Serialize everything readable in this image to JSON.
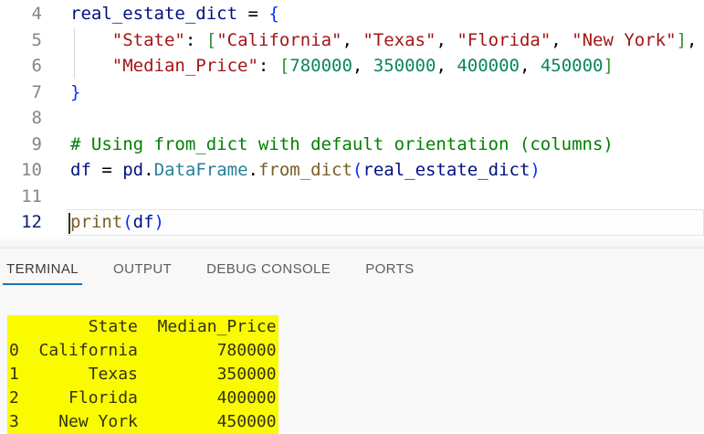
{
  "editor": {
    "background": "#ffffff",
    "active_line": "12",
    "token_colors": {
      "v": "#001080",
      "p": "#000000",
      "s": "#A31515",
      "n": "#098658",
      "c": "#008000",
      "f": "#795E26",
      "t": "#267F99",
      "b1": "#0431FA",
      "b2": "#319331"
    },
    "lines": [
      {
        "num": "4",
        "tokens": [
          [
            "real_estate_dict",
            "v"
          ],
          [
            " = ",
            "p"
          ],
          [
            "{",
            "b1"
          ]
        ]
      },
      {
        "num": "5",
        "tokens": [
          [
            "    ",
            "p"
          ],
          [
            "\"State\"",
            "s"
          ],
          [
            ": ",
            "p"
          ],
          [
            "[",
            "b2"
          ],
          [
            "\"California\"",
            "s"
          ],
          [
            ", ",
            "p"
          ],
          [
            "\"Texas\"",
            "s"
          ],
          [
            ", ",
            "p"
          ],
          [
            "\"Florida\"",
            "s"
          ],
          [
            ", ",
            "p"
          ],
          [
            "\"New York\"",
            "s"
          ],
          [
            "]",
            "b2"
          ],
          [
            ",",
            "p"
          ]
        ]
      },
      {
        "num": "6",
        "tokens": [
          [
            "    ",
            "p"
          ],
          [
            "\"Median_Price\"",
            "s"
          ],
          [
            ": ",
            "p"
          ],
          [
            "[",
            "b2"
          ],
          [
            "780000",
            "n"
          ],
          [
            ", ",
            "p"
          ],
          [
            "350000",
            "n"
          ],
          [
            ", ",
            "p"
          ],
          [
            "400000",
            "n"
          ],
          [
            ", ",
            "p"
          ],
          [
            "450000",
            "n"
          ],
          [
            "]",
            "b2"
          ]
        ]
      },
      {
        "num": "7",
        "tokens": [
          [
            "}",
            "b1"
          ]
        ]
      },
      {
        "num": "8",
        "tokens": []
      },
      {
        "num": "9",
        "tokens": [
          [
            "# Using from_dict with default orientation (columns)",
            "c"
          ]
        ]
      },
      {
        "num": "10",
        "tokens": [
          [
            "df",
            "v"
          ],
          [
            " = ",
            "p"
          ],
          [
            "pd",
            "v"
          ],
          [
            ".",
            "p"
          ],
          [
            "DataFrame",
            "t"
          ],
          [
            ".",
            "p"
          ],
          [
            "from_dict",
            "f"
          ],
          [
            "(",
            "b1"
          ],
          [
            "real_estate_dict",
            "v"
          ],
          [
            ")",
            "b1"
          ]
        ]
      },
      {
        "num": "11",
        "tokens": []
      },
      {
        "num": "12",
        "tokens": [
          [
            "print",
            "f"
          ],
          [
            "(",
            "b1"
          ],
          [
            "df",
            "v"
          ],
          [
            ")",
            "b1"
          ]
        ]
      }
    ]
  },
  "panel": {
    "accent": "#1F6FB5",
    "tabs": [
      {
        "label": "TERMINAL",
        "active": true
      },
      {
        "label": "OUTPUT",
        "active": false
      },
      {
        "label": "DEBUG CONSOLE",
        "active": false
      },
      {
        "label": "PORTS",
        "active": false
      }
    ],
    "terminal": {
      "selection_color": "#FBFB00",
      "output_lines": [
        "        State  Median_Price",
        "0  California        780000",
        "1       Texas        350000",
        "2     Florida        400000",
        "3    New York        450000"
      ]
    }
  }
}
